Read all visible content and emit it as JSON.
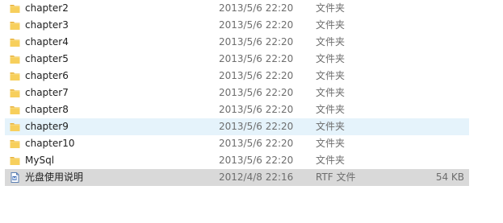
{
  "file_list": {
    "rows": [
      {
        "name": "chapter2",
        "date": "2013/5/6 22:20",
        "type": "文件夹",
        "size": "",
        "icon": "folder-icon"
      },
      {
        "name": "chapter3",
        "date": "2013/5/6 22:20",
        "type": "文件夹",
        "size": "",
        "icon": "folder-icon"
      },
      {
        "name": "chapter4",
        "date": "2013/5/6 22:20",
        "type": "文件夹",
        "size": "",
        "icon": "folder-icon"
      },
      {
        "name": "chapter5",
        "date": "2013/5/6 22:20",
        "type": "文件夹",
        "size": "",
        "icon": "folder-icon"
      },
      {
        "name": "chapter6",
        "date": "2013/5/6 22:20",
        "type": "文件夹",
        "size": "",
        "icon": "folder-icon"
      },
      {
        "name": "chapter7",
        "date": "2013/5/6 22:20",
        "type": "文件夹",
        "size": "",
        "icon": "folder-icon"
      },
      {
        "name": "chapter8",
        "date": "2013/5/6 22:20",
        "type": "文件夹",
        "size": "",
        "icon": "folder-icon"
      },
      {
        "name": "chapter9",
        "date": "2013/5/6 22:20",
        "type": "文件夹",
        "size": "",
        "icon": "folder-icon",
        "state": "hover"
      },
      {
        "name": "chapter10",
        "date": "2013/5/6 22:20",
        "type": "文件夹",
        "size": "",
        "icon": "folder-icon"
      },
      {
        "name": "MySql",
        "date": "2013/5/6 22:20",
        "type": "文件夹",
        "size": "",
        "icon": "folder-icon"
      },
      {
        "name": "光盘使用说明",
        "date": "2012/4/8 22:16",
        "type": "RTF 文件",
        "size": "54 KB",
        "icon": "rtf-document-icon",
        "state": "selected"
      }
    ]
  },
  "colors": {
    "folder": "#f5c342",
    "hover_bg": "#e5f3fb",
    "selected_bg": "#d9d9d9",
    "muted_text": "#6d6d6d"
  }
}
